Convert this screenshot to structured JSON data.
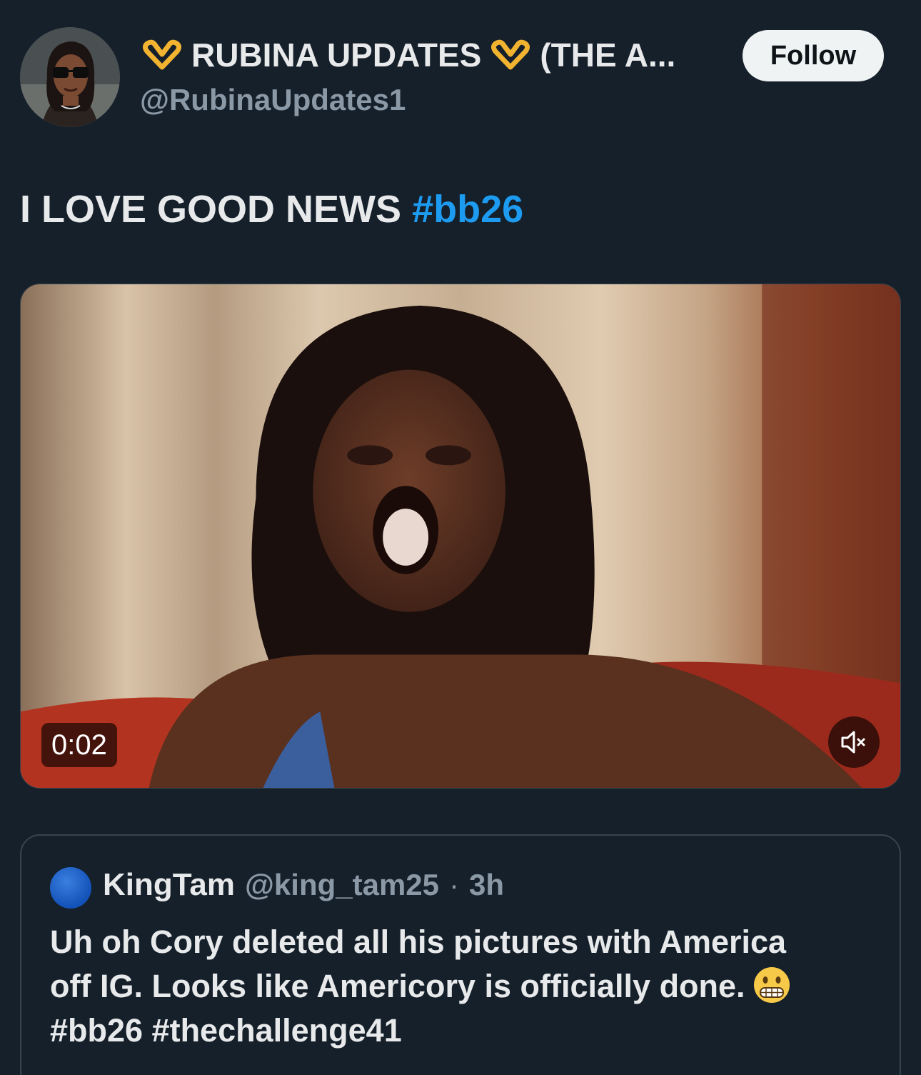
{
  "author": {
    "display_name": "RUBINA UPDATES",
    "display_name_suffix": "(THE A...",
    "handle": "@RubinaUpdates1",
    "avatar_icon": "profile-photo",
    "decoration_icon": "heart-hands-emoji"
  },
  "follow_label": "Follow",
  "tweet": {
    "text": "I LOVE GOOD NEWS",
    "hashtag": "#bb26"
  },
  "video": {
    "elapsed": "0:02",
    "mute_icon": "speaker-muted-icon"
  },
  "quote": {
    "name": "KingTam",
    "handle": "@king_tam25",
    "separator": "·",
    "time": "3h",
    "line1": "Uh oh Cory deleted all his pictures with America",
    "line2": "off IG. Looks like Americory is officially done.",
    "emoji_icon": "grimacing-face-emoji",
    "line3": "#bb26 #thechallenge41"
  },
  "colors": {
    "background": "#15202b",
    "link": "#1d9bf0",
    "secondary_text": "#8b98a5",
    "border": "#38444d"
  }
}
